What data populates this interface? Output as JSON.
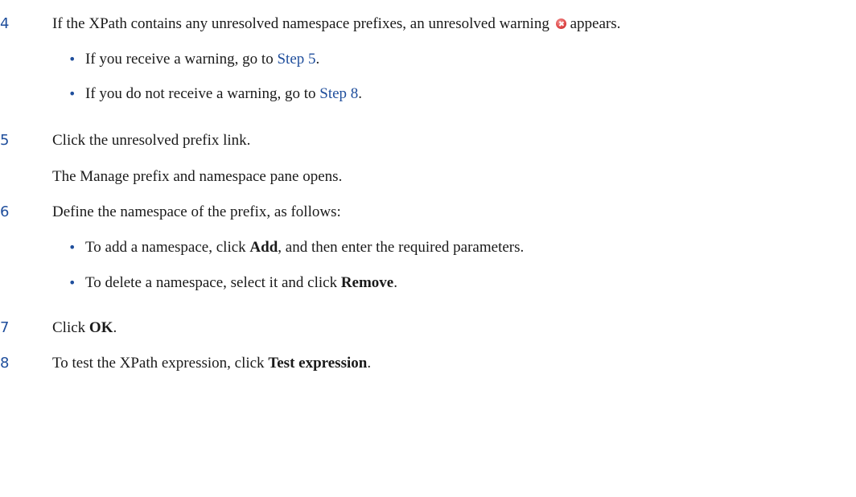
{
  "steps": {
    "s4": {
      "number": "4",
      "text_before_icon": "If the XPath contains any unresolved namespace prefixes, an unresolved warning",
      "text_after_icon": "appears.",
      "icon": "warning-icon",
      "bullets": [
        {
          "prefix": "If you receive a warning, go to",
          "link": "Step 5",
          "suffix": "."
        },
        {
          "prefix": "If you do not receive a warning, go to",
          "link": "Step 8",
          "suffix": "."
        }
      ]
    },
    "s5": {
      "number": "5",
      "text": "Click the unresolved prefix link.",
      "result": "The Manage prefix and namespace pane opens."
    },
    "s6": {
      "number": "6",
      "text": "Define the namespace of the prefix, as follows:",
      "bullets": [
        {
          "prefix": "To add a namespace, click",
          "bold": "Add",
          "suffix": ", and then enter the required parameters."
        },
        {
          "prefix": "To delete a namespace, select it and click",
          "bold": "Remove",
          "suffix": "."
        }
      ]
    },
    "s7": {
      "number": "7",
      "prefix": "Click",
      "bold": "OK",
      "suffix": "."
    },
    "s8": {
      "number": "8",
      "prefix": "To test the XPath expression, click",
      "bold": "Test expression",
      "suffix": "."
    }
  },
  "bullet_char": "•",
  "colors": {
    "accent": "#1f4e9c",
    "text": "#1a1a1a",
    "warning": "#e04a4a"
  }
}
